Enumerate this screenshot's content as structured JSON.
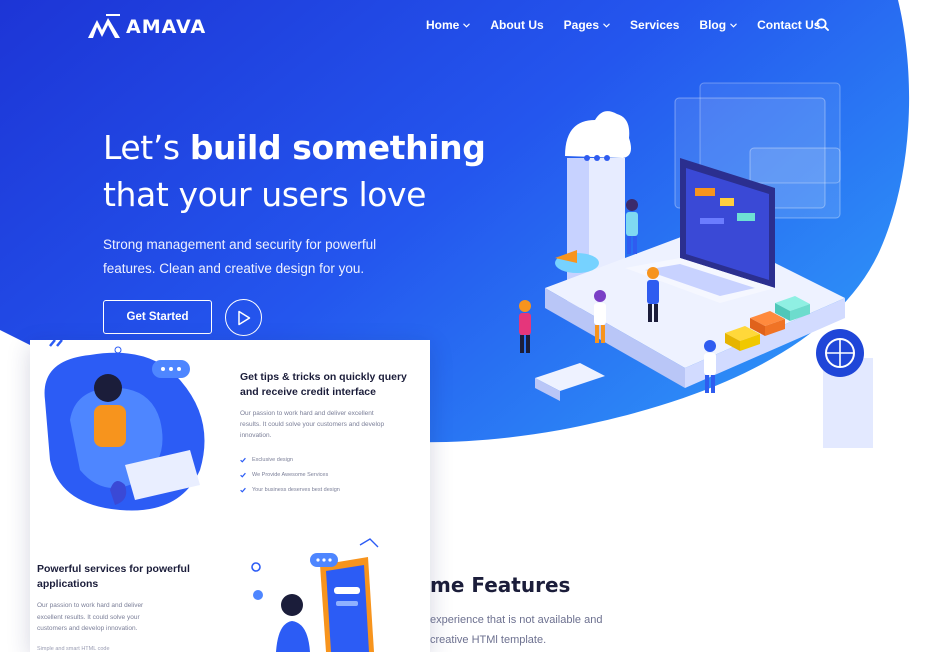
{
  "brand": {
    "name": "AMAVA"
  },
  "nav": {
    "items": [
      {
        "label": "Home",
        "has_dropdown": true
      },
      {
        "label": "About Us",
        "has_dropdown": false
      },
      {
        "label": "Pages",
        "has_dropdown": true
      },
      {
        "label": "Services",
        "has_dropdown": false
      },
      {
        "label": "Blog",
        "has_dropdown": true
      },
      {
        "label": "Contact Us",
        "has_dropdown": false
      }
    ],
    "search_icon": "search-icon"
  },
  "hero": {
    "title_line1_plain": "Let’s ",
    "title_line1_bold": "build something",
    "title_line2": "that your users love",
    "subtitle": "Strong management and security for powerful features. Clean and creative design for you.",
    "cta_label": "Get Started",
    "play_icon": "play-icon"
  },
  "card": {
    "tip_title_plain": "Get tips & tricks on quickly ",
    "tip_title_bold": "query and receive credit interface",
    "tip_body": "Our passion to work hard and deliver excellent results. It could solve your customers and develop innovation.",
    "tip_list": [
      "Exclusive design",
      "We Provide Awesome Services",
      "Your business deserves best design"
    ],
    "services_title_plain": "Powerful services for ",
    "services_title_bold": "powerful applications",
    "services_body": "Our passion to work hard and deliver excellent results. It could solve your customers and develop innovation.",
    "services_list_first": "Simple and smart HTML code"
  },
  "features": {
    "title": "me Features",
    "body": "experience that is not available and creative HTMl template."
  },
  "colors": {
    "hero_gradient_start": "#1f3bd8",
    "hero_gradient_end": "#2d8cf7",
    "text_dark": "#1b1d3a",
    "text_muted": "#7b7f98",
    "accent_blue": "#2c5cf5",
    "accent_orange": "#f7941d"
  }
}
